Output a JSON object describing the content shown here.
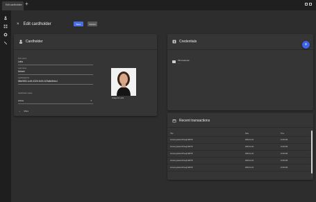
{
  "app": {
    "tab_title": "Edit cardholder",
    "tab_close": "×",
    "tab_add": "+"
  },
  "rail": {
    "icons": [
      "person-icon",
      "grid-icon",
      "gear-icon",
      "wrench-icon"
    ]
  },
  "page": {
    "close_glyph": "×",
    "title": "Edit cardholder",
    "save_label": "Save",
    "cancel_label": "Cancel"
  },
  "cardholder": {
    "title": "Cardholder",
    "fields": [
      {
        "label": "First name",
        "value": "Leila"
      },
      {
        "label": "Last name",
        "value": "Hebert"
      },
      {
        "label": "Cardholder ID",
        "value": "8fbe9f53-1cb9-4326-9c50-1f2fa8e8b4c4"
      }
    ],
    "status_label": "Cardholder status",
    "status_value": "Active",
    "photo_caption": "Image for Leila",
    "more_label": "More"
  },
  "credentials": {
    "title": "Credentials",
    "add_glyph": "+",
    "item_label": "PIN credential",
    "item_sub": "----"
  },
  "transactions": {
    "title": "Recent transactions",
    "columns": {
      "desc": "Title",
      "date": "Date",
      "time": "Time"
    },
    "rows": [
      {
        "desc": "Access granted through ENTR",
        "date": "2023-12-21",
        "time": "10:40 AM"
      },
      {
        "desc": "Access granted through ENTR",
        "date": "2023-12-21",
        "time": "10:40 AM"
      },
      {
        "desc": "Access granted through ENTR",
        "date": "2023-12-21",
        "time": "10:40 AM"
      },
      {
        "desc": "Access granted through ENTR",
        "date": "2023-12-21",
        "time": "10:40 AM"
      },
      {
        "desc": "Access granted through ENTR",
        "date": "2023-12-21",
        "time": "10:40 AM"
      }
    ]
  },
  "colors": {
    "accent": "#4a6fe0",
    "fab": "#3f63e6",
    "background": "#2b2b2b",
    "card": "#353535"
  }
}
